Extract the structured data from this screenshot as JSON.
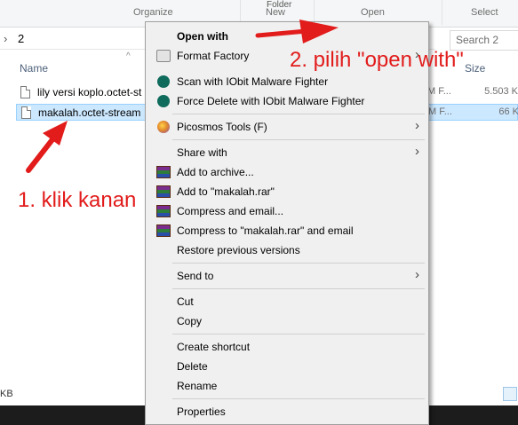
{
  "ribbon": {
    "groups": [
      "Organize",
      "New",
      "Open",
      "Select"
    ],
    "stub_text": "Folder"
  },
  "address": {
    "crumb": "2",
    "chev": "›"
  },
  "search": {
    "placeholder": "Search 2"
  },
  "columns": {
    "name": "Name",
    "size": "Size"
  },
  "files": [
    {
      "name": "lily versi koplo.octet-st",
      "type": "M F...",
      "size": "5.503 K",
      "selected": false
    },
    {
      "name": "makalah.octet-stream",
      "type": "M F...",
      "size": "66 K",
      "selected": true
    }
  ],
  "status": {
    "text": "KB"
  },
  "context_menu": {
    "items": [
      {
        "label": "Open with",
        "bold": true,
        "icon": ""
      },
      {
        "label": "Format Factory",
        "icon": "format-factory-icon",
        "submenu": true
      },
      {
        "label": "Scan with IObit Malware Fighter",
        "icon": "iobit-icon"
      },
      {
        "label": "Force Delete with IObit Malware Fighter",
        "icon": "iobit-icon"
      },
      {
        "label": "Picosmos Tools (F)",
        "icon": "picosmos-icon",
        "submenu": true
      },
      {
        "label": "Share with",
        "icon": "",
        "submenu": true
      },
      {
        "label": "Add to archive...",
        "icon": "winrar-icon"
      },
      {
        "label": "Add to \"makalah.rar\"",
        "icon": "winrar-icon"
      },
      {
        "label": "Compress and email...",
        "icon": "winrar-icon"
      },
      {
        "label": "Compress to \"makalah.rar\" and email",
        "icon": "winrar-icon"
      },
      {
        "label": "Restore previous versions",
        "icon": ""
      },
      {
        "label": "Send to",
        "icon": "",
        "submenu": true
      },
      {
        "label": "Cut",
        "icon": ""
      },
      {
        "label": "Copy",
        "icon": ""
      },
      {
        "label": "Create shortcut",
        "icon": ""
      },
      {
        "label": "Delete",
        "icon": ""
      },
      {
        "label": "Rename",
        "icon": ""
      },
      {
        "label": "Properties",
        "icon": ""
      }
    ],
    "submenu_arrow": "›"
  },
  "annotations": {
    "step1": "1. klik kanan",
    "step2": "2. pilih \"open with\"",
    "color": "#e21b1b"
  }
}
